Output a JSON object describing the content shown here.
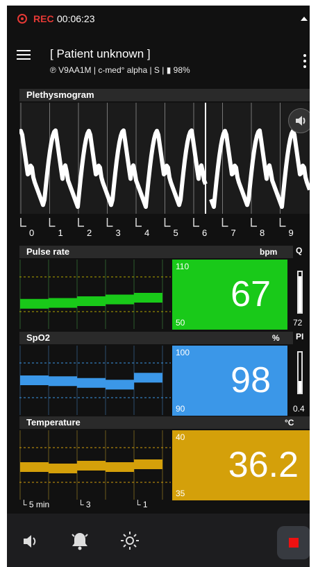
{
  "status": {
    "rec_label": "REC",
    "rec_time": "00:06:23"
  },
  "header": {
    "title": "[ Patient unknown ]",
    "subtitle": "℗ V9AA1M | c-med° alpha | S | ▮ 98%"
  },
  "pleth": {
    "title": "Plethysmogram",
    "axis_ticks": [
      "0",
      "1",
      "2",
      "3",
      "4",
      "5",
      "6",
      "7",
      "8",
      "9"
    ]
  },
  "pulse": {
    "title": "Pulse rate",
    "unit": "bpm",
    "value": "67",
    "high": "110",
    "low": "50",
    "color": "#19c919",
    "side_label": "Q",
    "side_value": "72",
    "side_level": 0.9,
    "trend": [
      49,
      50,
      52,
      54,
      56
    ]
  },
  "spo2": {
    "title": "SpO2",
    "unit": "%",
    "value": "98",
    "high": "100",
    "low": "90",
    "color": "#3b97e8",
    "side_label": "PI",
    "side_value": "0.4",
    "side_level": 0.3,
    "trend": [
      98,
      97.9,
      97.7,
      97.5,
      98.3
    ]
  },
  "temp": {
    "title": "Temperature",
    "unit": "°C",
    "value": "36.2",
    "high": "40",
    "low": "35",
    "color": "#d4a00a",
    "trend": [
      36.1,
      36.0,
      36.2,
      36.1,
      36.3
    ]
  },
  "time_axis": [
    "5 min",
    "3",
    "1"
  ],
  "toolbar": {
    "icons": [
      "speaker-icon",
      "bell-icon",
      "brightness-icon",
      "stop-icon"
    ]
  }
}
